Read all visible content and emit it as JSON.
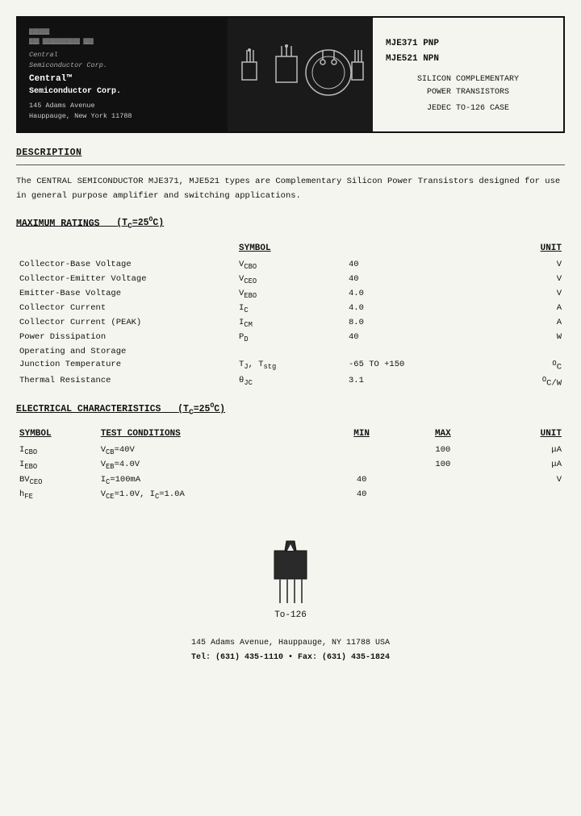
{
  "header": {
    "logo_lines": [
      "CENTRAL",
      "SEMIconductor Corp.",
      "Central",
      "Semiconductor Corp."
    ],
    "company_name": "Central™",
    "company_full": "Semiconductor Corp.",
    "address_line1": "145 Adams Avenue",
    "address_line2": "Hauppauge, New York 11788",
    "part1": "MJE371 PNP",
    "part2": "MJE521 NPN",
    "subtitle1": "SILICON COMPLEMENTARY",
    "subtitle2": "POWER TRANSISTORS",
    "case": "JEDEC TO-126 CASE"
  },
  "description": {
    "title": "DESCRIPTION",
    "text": "The CENTRAL SEMICONDUCTOR MJE371, MJE521 types are Complementary Silicon Power Transistors designed for use in general purpose amplifier and switching applications."
  },
  "maximum_ratings": {
    "title": "MAXIMUM RATINGS",
    "condition": "(T",
    "condition_sub": "C",
    "condition_eq": "=25",
    "condition_sup": "O",
    "condition_end": "C)",
    "col_symbol": "SYMBOL",
    "col_unit": "UNIT",
    "rows": [
      {
        "param": "Collector-Base Voltage",
        "symbol": "V",
        "sym_sub": "CBO",
        "value": "40",
        "unit": "V"
      },
      {
        "param": "Collector-Emitter Voltage",
        "symbol": "V",
        "sym_sub": "CEO",
        "value": "40",
        "unit": "V"
      },
      {
        "param": "Emitter-Base Voltage",
        "symbol": "V",
        "sym_sub": "EBO",
        "value": "4.0",
        "unit": "V"
      },
      {
        "param": "Collector Current",
        "symbol": "I",
        "sym_sub": "C",
        "value": "4.0",
        "unit": "A"
      },
      {
        "param": "Collector Current (PEAK)",
        "symbol": "I",
        "sym_sub": "CM",
        "value": "8.0",
        "unit": "A"
      },
      {
        "param": "Power Dissipation",
        "symbol": "P",
        "sym_sub": "D",
        "value": "40",
        "unit": "W"
      },
      {
        "param": "Operating and Storage",
        "symbol": "",
        "sym_sub": "",
        "value": "",
        "unit": ""
      },
      {
        "param": "Junction Temperature",
        "symbol": "T",
        "sym_sub": "J",
        "symbol2": ", T",
        "sym2_sub": "stg",
        "value": "-65 TO +150",
        "unit": "°C"
      },
      {
        "param": "Thermal Resistance",
        "symbol": "θ",
        "sym_sub": "JC",
        "value": "3.1",
        "unit": "°C/W"
      }
    ]
  },
  "electrical": {
    "title": "ELECTRICAL CHARACTERISTICS",
    "condition": "(T",
    "condition_sub": "C",
    "condition_eq": "=25",
    "condition_sup": "O",
    "condition_end": "C)",
    "col_symbol": "SYMBOL",
    "col_conditions": "TEST CONDITIONS",
    "col_min": "MIN",
    "col_max": "MAX",
    "col_unit": "UNIT",
    "rows": [
      {
        "symbol": "I",
        "sym_sub": "CBO",
        "condition": "V",
        "cond_sub": "CB",
        "cond_eq": "=40V",
        "min": "",
        "max": "100",
        "unit": "μA"
      },
      {
        "symbol": "I",
        "sym_sub": "EBO",
        "condition": "V",
        "cond_sub": "EB",
        "cond_eq": "=4.0V",
        "min": "",
        "max": "100",
        "unit": "μA"
      },
      {
        "symbol": "BV",
        "sym_sub": "CEO",
        "condition": "I",
        "cond_sub": "C",
        "cond_eq": "=100mA",
        "min": "40",
        "max": "",
        "unit": "V"
      },
      {
        "symbol": "h",
        "sym_sub": "FE",
        "condition": "V",
        "cond_sub": "CE",
        "cond_eq": "=1.0V, I",
        "cond_sub2": "C",
        "cond_eq2": "=1.0A",
        "min": "40",
        "max": "",
        "unit": ""
      }
    ]
  },
  "diagram": {
    "label": "To-126"
  },
  "footer": {
    "address": "145 Adams Avenue, Hauppauge, NY  11788  USA",
    "tel": "Tel: (631) 435-1110  •  Fax: (631) 435-1824"
  }
}
